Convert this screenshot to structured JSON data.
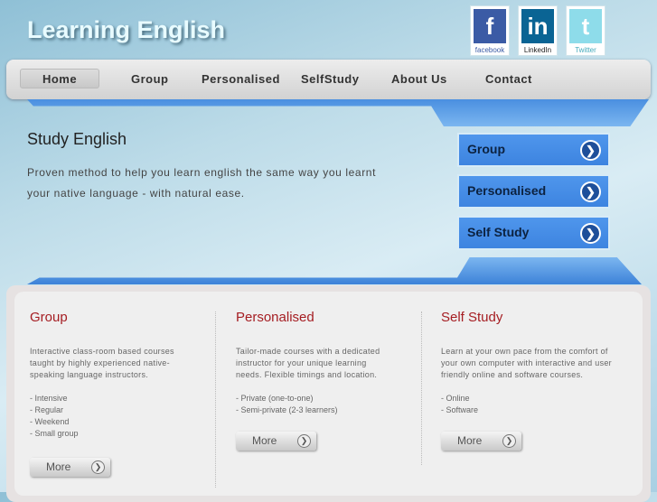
{
  "header": {
    "logo": "Learning English"
  },
  "social": [
    {
      "icon": "f",
      "label": "facebook",
      "color": "#3b5ba5"
    },
    {
      "icon": "in",
      "label": "LinkedIn",
      "color": "#0a6494"
    },
    {
      "icon": "t",
      "label": "Twitter",
      "color": "#8edcea"
    }
  ],
  "nav": [
    "Home",
    "Group",
    "Personalised",
    "SelfStudy",
    "About Us",
    "Contact"
  ],
  "hero": {
    "title": "Study English",
    "text": "Proven method to help you learn english the same way you learnt your native language - with natural ease."
  },
  "side_buttons": [
    "Group",
    "Personalised",
    "Self Study"
  ],
  "columns": [
    {
      "title": "Group",
      "text": "Interactive class-room based courses taught by highly experienced native-speaking language instructors.",
      "items": [
        "- Intensive",
        "- Regular",
        "- Weekend",
        "- Small group"
      ],
      "more": "More"
    },
    {
      "title": "Personalised",
      "text": "Tailor-made courses with a dedicated instructor for your unique learning needs. Flexible timings and location.",
      "items": [
        "- Private (one-to-one)",
        "- Semi-private (2-3 learners)"
      ],
      "more": "More"
    },
    {
      "title": "Self Study",
      "text": "Learn at your own pace from the comfort of your own computer with interactive and user friendly online and software courses.",
      "items": [
        "- Online",
        "- Software"
      ],
      "more": "More"
    }
  ]
}
